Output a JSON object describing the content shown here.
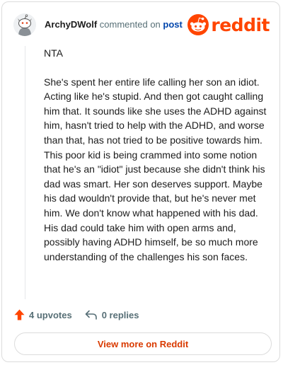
{
  "comment": {
    "username": "ArchyDWolf",
    "commented_text": "commented on",
    "post_link_label": "post",
    "paragraphs": [
      "NTA",
      "She's spent her entire life calling her son an idiot. Acting like he's stupid. And then got caught calling him that. It sounds like she uses the ADHD against him, hasn't tried to help with the ADHD, and worse than that, has not tried to be positive towards him. This poor kid is being crammed into some notion that he's an \"idiot\" just because she didn't think his dad was smart. Her son deserves support. Maybe his dad wouldn't provide that, but he's never met him. We don't know what happened with his dad. His dad could take him with open arms and, possibly having ADHD himself, be so much more understanding of the challenges his son faces."
    ],
    "upvotes_label": "4 upvotes",
    "replies_label": "0 replies"
  },
  "brand": {
    "wordmark": "reddit",
    "color": "#ff4500"
  },
  "footer": {
    "view_more_label": "View more on Reddit"
  },
  "icons": {
    "avatar": "snoo-avatar-icon",
    "upvote": "upvote-arrow-icon",
    "reply": "reply-icon"
  }
}
